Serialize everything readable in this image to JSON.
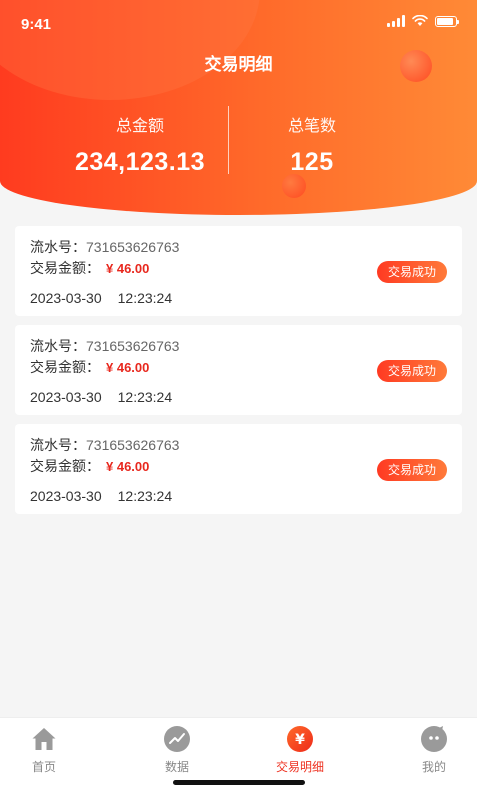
{
  "status_bar": {
    "time": "9:41"
  },
  "header": {
    "title": "交易明细",
    "total_amount_label": "总金额",
    "total_amount_value": "234,123.13",
    "total_count_label": "总笔数",
    "total_count_value": "125",
    "colors": {
      "gradient_start": "#ff3b1f",
      "gradient_end": "#ff8a36"
    }
  },
  "transactions": [
    {
      "serial_label": "流水号：",
      "serial": "731653626763",
      "amount_label": "交易金额：",
      "amount": "¥ 46.00",
      "date": "2023-03-30",
      "time": "12:23:24",
      "status": "交易成功"
    },
    {
      "serial_label": "流水号：",
      "serial": "731653626763",
      "amount_label": "交易金额：",
      "amount": "¥ 46.00",
      "date": "2023-03-30",
      "time": "12:23:24",
      "status": "交易成功"
    },
    {
      "serial_label": "流水号：",
      "serial": "731653626763",
      "amount_label": "交易金额：",
      "amount": "¥ 46.00",
      "date": "2023-03-30",
      "time": "12:23:24",
      "status": "交易成功"
    }
  ],
  "tabbar": {
    "active_color": "#ee3322",
    "items": [
      {
        "label": "首页",
        "icon": "home-icon"
      },
      {
        "label": "数据",
        "icon": "trend-icon"
      },
      {
        "label": "交易明细",
        "icon": "yen-icon"
      },
      {
        "label": "我的",
        "icon": "profile-icon"
      }
    ]
  }
}
